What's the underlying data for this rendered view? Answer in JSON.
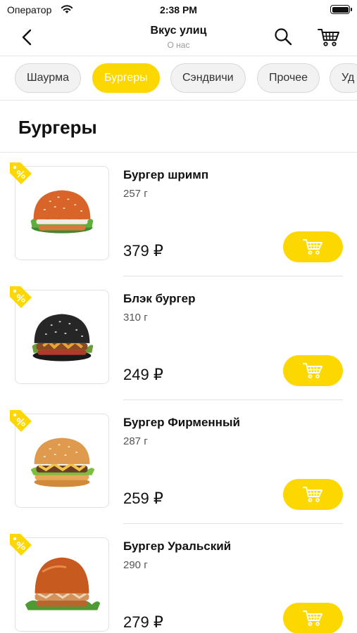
{
  "status_bar": {
    "carrier": "Оператор",
    "time": "2:38 PM"
  },
  "nav": {
    "title": "Вкус улиц",
    "subtitle": "О нас"
  },
  "categories": [
    {
      "label": "Шаурма",
      "active": false
    },
    {
      "label": "Бургеры",
      "active": true
    },
    {
      "label": "Сэндвичи",
      "active": false
    },
    {
      "label": "Прочее",
      "active": false
    },
    {
      "label": "Уд",
      "active": false
    }
  ],
  "section": {
    "title": "Бургеры"
  },
  "products": [
    {
      "name": "Бургер шримп",
      "weight": "257 г",
      "price": "379 ₽",
      "bun": "orange"
    },
    {
      "name": "Блэк бургер",
      "weight": "310 г",
      "price": "249 ₽",
      "bun": "black"
    },
    {
      "name": "Бургер Фирменный",
      "weight": "287 г",
      "price": "259 ₽",
      "bun": "golden"
    },
    {
      "name": "Бургер Уральский",
      "weight": "290 г",
      "price": "279 ₽",
      "bun": "dark-orange"
    }
  ],
  "colors": {
    "accent": "#fcd800",
    "discount_tag": "#fcd800"
  },
  "icons": {
    "back": "chevron-left-icon",
    "search": "search-icon",
    "cart": "cart-icon",
    "discount": "percent-tag-icon",
    "add_to_cart": "cart-icon",
    "wifi": "wifi-icon",
    "battery": "battery-icon"
  }
}
